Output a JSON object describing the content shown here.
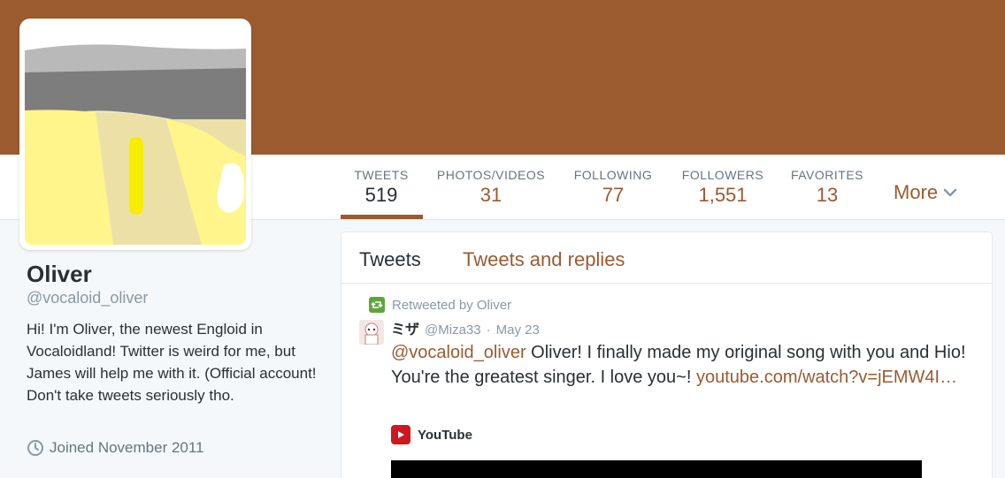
{
  "profile": {
    "name": "Oliver",
    "handle": "@vocaloid_oliver",
    "bio": "Hi! I'm Oliver, the newest Engloid in Vocaloidland! Twitter is weird for me, but James will help me with it. (Official account! Don't take tweets seriously tho.",
    "joined": "Joined November 2011"
  },
  "stats": {
    "tweets": {
      "label": "TWEETS",
      "value": "519"
    },
    "photos": {
      "label": "PHOTOS/VIDEOS",
      "value": "31"
    },
    "following": {
      "label": "FOLLOWING",
      "value": "77"
    },
    "followers": {
      "label": "FOLLOWERS",
      "value": "1,551"
    },
    "favorites": {
      "label": "FAVORITES",
      "value": "13"
    },
    "more_label": "More"
  },
  "timeline": {
    "tabs": [
      {
        "label": "Tweets"
      },
      {
        "label": "Tweets and replies"
      }
    ],
    "tweet": {
      "retweeted_by": "Retweeted by Oliver",
      "author_name": "ミザ",
      "author_handle": "@Miza33",
      "separator": "·",
      "date": "May 23",
      "mention": "@vocaloid_oliver",
      "text": "Oliver! I finally made my original song with you and Hio! You're the greatest singer. I love you~!",
      "link": "youtube.com/watch?v=jEMW4I…",
      "card_source": "YouTube"
    }
  },
  "colors": {
    "brand": "#9c5a2f",
    "retweet": "#5ea63b",
    "youtube": "#cc181e"
  }
}
